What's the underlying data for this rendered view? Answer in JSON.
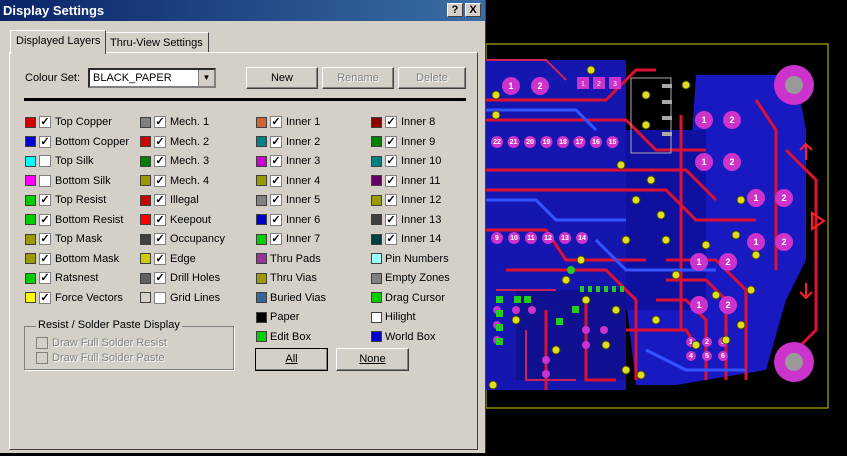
{
  "window": {
    "title": "Display Settings",
    "help_btn": "?",
    "close_btn": "X"
  },
  "tabs": [
    {
      "label": "Displayed Layers",
      "active": true
    },
    {
      "label": "Thru-View Settings",
      "active": false
    }
  ],
  "colour_set": {
    "label": "Colour Set:",
    "value": "BLACK_PAPER"
  },
  "buttons": {
    "new": "New",
    "rename": "Rename",
    "delete": "Delete",
    "all": "All",
    "none": "None"
  },
  "layers": [
    [
      {
        "label": "Top Copper",
        "color": "#cc0000",
        "checked": true
      },
      {
        "label": "Bottom Copper",
        "color": "#0000cc",
        "checked": true
      },
      {
        "label": "Top Silk",
        "color": "#00ffff",
        "checked": false
      },
      {
        "label": "Bottom Silk",
        "color": "#ff00ff",
        "checked": false
      },
      {
        "label": "Top Resist",
        "color": "#00cc00",
        "checked": true
      },
      {
        "label": "Bottom Resist",
        "color": "#00cc00",
        "checked": true
      },
      {
        "label": "Top Mask",
        "color": "#999900",
        "checked": true
      },
      {
        "label": "Bottom Mask",
        "color": "#999900",
        "checked": true
      },
      {
        "label": "Ratsnest",
        "color": "#00cc00",
        "checked": true
      },
      {
        "label": "Force Vectors",
        "color": "#ffff00",
        "checked": true
      }
    ],
    [
      {
        "label": "Mech. 1",
        "color": "#808080",
        "checked": true
      },
      {
        "label": "Mech. 2",
        "color": "#cc0000",
        "checked": true
      },
      {
        "label": "Mech. 3",
        "color": "#008000",
        "checked": true
      },
      {
        "label": "Mech. 4",
        "color": "#999900",
        "checked": true
      },
      {
        "label": "Illegal",
        "color": "#cc0000",
        "checked": true
      },
      {
        "label": "Keepout",
        "color": "#ff0000",
        "checked": true
      },
      {
        "label": "Occupancy",
        "color": "#404040",
        "checked": true
      },
      {
        "label": "Edge",
        "color": "#cccc00",
        "checked": true
      },
      {
        "label": "Drill Holes",
        "color": "#606060",
        "checked": true
      },
      {
        "label": "Grid Lines",
        "color": "#d4d0c8",
        "checked": false
      }
    ],
    [
      {
        "label": "Inner 1",
        "color": "#cc6633",
        "checked": true
      },
      {
        "label": "Inner 2",
        "color": "#008080",
        "checked": true
      },
      {
        "label": "Inner 3",
        "color": "#cc00cc",
        "checked": true
      },
      {
        "label": "Inner 4",
        "color": "#999900",
        "checked": true
      },
      {
        "label": "Inner 5",
        "color": "#808080",
        "checked": true
      },
      {
        "label": "Inner 6",
        "color": "#0000cc",
        "checked": true
      },
      {
        "label": "Inner 7",
        "color": "#00cc00",
        "checked": true
      },
      {
        "label": "Thru Pads",
        "color": "#993399",
        "checked": false
      },
      {
        "label": "Thru Vias",
        "color": "#999900",
        "checked": false
      },
      {
        "label": "Buried Vias",
        "color": "#336699",
        "checked": false
      },
      {
        "label": "Paper",
        "color": "#000000",
        "checked": false
      },
      {
        "label": "Edit Box",
        "color": "#00cc00",
        "checked": false
      }
    ],
    [
      {
        "label": "Inner 8",
        "color": "#880000",
        "checked": true
      },
      {
        "label": "Inner 9",
        "color": "#008000",
        "checked": true
      },
      {
        "label": "Inner 10",
        "color": "#008080",
        "checked": true
      },
      {
        "label": "Inner 11",
        "color": "#660066",
        "checked": true
      },
      {
        "label": "Inner 12",
        "color": "#999900",
        "checked": true
      },
      {
        "label": "Inner 13",
        "color": "#404040",
        "checked": true
      },
      {
        "label": "Inner 14",
        "color": "#004040",
        "checked": true
      },
      {
        "label": "Pin Numbers",
        "color": "#99ffff",
        "checked": false
      },
      {
        "label": "Empty Zones",
        "color": "#808080",
        "checked": false
      },
      {
        "label": "Drag Cursor",
        "color": "#00cc00",
        "checked": false
      },
      {
        "label": "Hilight",
        "color": "#ffffff",
        "checked": false
      },
      {
        "label": "World Box",
        "color": "#0000cc",
        "checked": false
      }
    ]
  ],
  "resist_group": {
    "title": "Resist / Solder Paste Display",
    "options": [
      "Draw Full Solder Resist",
      "Draw Full Solder Paste"
    ]
  },
  "pcb": {
    "pad_numbers_top": [
      "1",
      "2",
      "3"
    ],
    "pad_numbers_row1": [
      "22",
      "21",
      "20",
      "19",
      "18",
      "17",
      "16",
      "15"
    ],
    "pad_numbers_row2": [
      "9",
      "10",
      "11",
      "12",
      "13",
      "14"
    ],
    "pad_numbers_small": [
      "1",
      "2",
      "3",
      "4",
      "5",
      "6"
    ],
    "big_pad_numbers": [
      "1",
      "2"
    ]
  }
}
